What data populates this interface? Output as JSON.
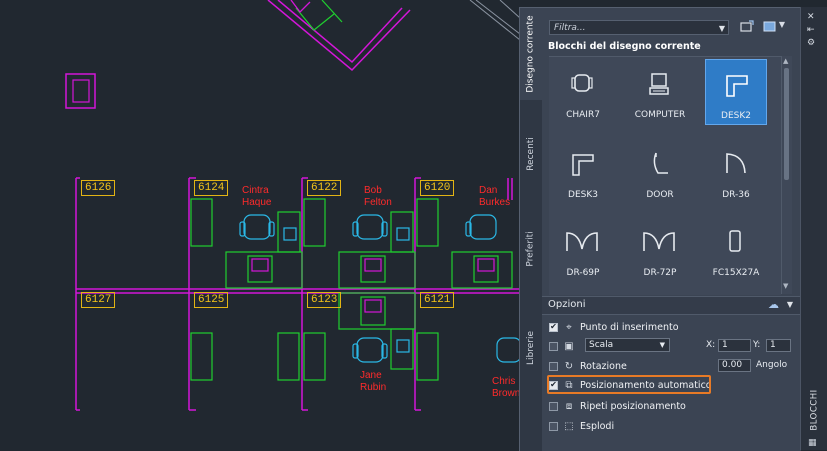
{
  "drawing": {
    "rooms": [
      "6126",
      "6124",
      "6122",
      "6120",
      "6127",
      "6125",
      "6123",
      "6121"
    ],
    "people": [
      {
        "first": "Cintra",
        "last": "Haque"
      },
      {
        "first": "Bob",
        "last": "Felton"
      },
      {
        "first": "Dan",
        "last": "Burkes"
      },
      {
        "first": "Jane",
        "last": "Rubin"
      },
      {
        "first": "Chris",
        "last": "Brown"
      }
    ]
  },
  "palette": {
    "tabs": [
      "Disegno corrente",
      "Recenti",
      "Preferiti",
      "Librerie"
    ],
    "filter_placeholder": "Filtra...",
    "section_title": "Blocchi del disegno corrente",
    "blocks": [
      {
        "name": "CHAIR7",
        "icon": "chair-icon"
      },
      {
        "name": "COMPUTER",
        "icon": "computer-icon"
      },
      {
        "name": "DESK2",
        "icon": "desk-icon",
        "selected": true
      },
      {
        "name": "DESK3",
        "icon": "desk-icon"
      },
      {
        "name": "DOOR",
        "icon": "door-icon"
      },
      {
        "name": "DR-36",
        "icon": "door-swing-icon"
      },
      {
        "name": "DR-69P",
        "icon": "double-door-icon"
      },
      {
        "name": "DR-72P",
        "icon": "double-door-icon"
      },
      {
        "name": "FC15X27A",
        "icon": "file-cabinet-icon"
      }
    ],
    "options_title": "Opzioni",
    "options": {
      "insertion_point": {
        "label": "Punto di inserimento",
        "checked": true
      },
      "scale": {
        "value": "Scala",
        "checked": false,
        "x_label": "X:",
        "x_value": "1",
        "y_label": "Y:",
        "y_value": "1"
      },
      "rotation": {
        "label": "Rotazione",
        "checked": false,
        "value": "0.00",
        "unit_label": "Angolo"
      },
      "auto_placement": {
        "label": "Posizionamento automatico",
        "checked": true
      },
      "repeat_placement": {
        "label": "Ripeti posizionamento",
        "checked": false
      },
      "explode": {
        "label": "Esplodi",
        "checked": false
      }
    },
    "side_title": "BLOCCHI"
  },
  "colors": {
    "canvas": "#212830",
    "magenta_walls": "#d316d8",
    "green_furniture": "#1fcf2f",
    "cyan_chairs": "#2bb8e6",
    "room_label": "#f4c41a",
    "person_label": "#ff2b2b",
    "selection": "#2f7cc7",
    "highlight": "#e77a26"
  }
}
